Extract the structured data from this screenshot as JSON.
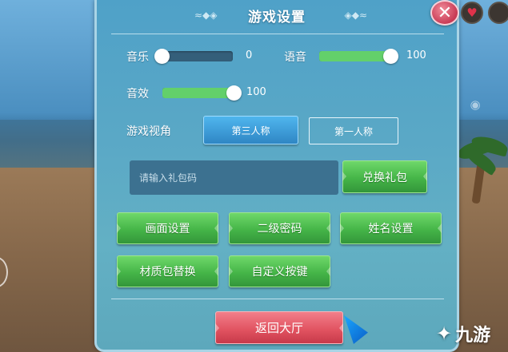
{
  "dialog": {
    "title": "游戏设置",
    "close_label": "✕"
  },
  "audio": {
    "music": {
      "label": "音乐",
      "value": "0",
      "level": 0
    },
    "voice": {
      "label": "语音",
      "value": "100",
      "level": 100
    },
    "sfx": {
      "label": "音效",
      "value": "100",
      "level": 100
    }
  },
  "view": {
    "label": "游戏视角",
    "options": [
      {
        "label": "第三人称",
        "selected": true
      },
      {
        "label": "第一人称",
        "selected": false
      }
    ]
  },
  "gift": {
    "placeholder": "请输入礼包码",
    "redeem_label": "兑换礼包"
  },
  "buttons": {
    "graphics": "画面设置",
    "second_password": "二级密码",
    "name_settings": "姓名设置",
    "texture_pack": "材质包替换",
    "custom_keys": "自定义按键"
  },
  "back_label": "返回大厅",
  "watermark": {
    "text": "九游"
  },
  "colors": {
    "panel": "#5aa8c6",
    "slider_fill": "#63d06a",
    "green_button": "#45b548",
    "red_button": "#e0515f",
    "active_tab": "#2f86c4",
    "close": "#c83a55"
  },
  "icons": {
    "close": "close-icon",
    "heart": "heart-icon",
    "eye": "eye-icon",
    "watermark": "nine-game-logo"
  }
}
